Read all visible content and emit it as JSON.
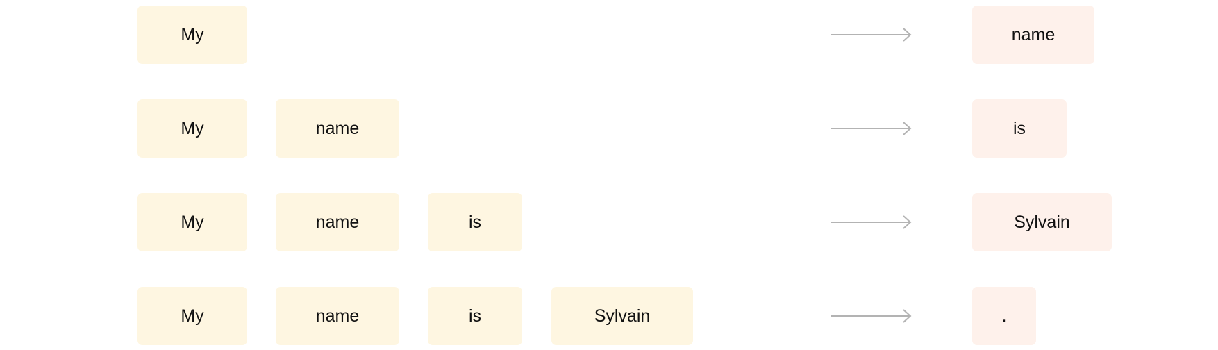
{
  "rows": [
    {
      "inputs": [
        "My"
      ],
      "output": "name"
    },
    {
      "inputs": [
        "My",
        "name"
      ],
      "output": "is"
    },
    {
      "inputs": [
        "My",
        "name",
        "is"
      ],
      "output": "Sylvain"
    },
    {
      "inputs": [
        "My",
        "name",
        "is",
        "Sylvain"
      ],
      "output": "."
    }
  ],
  "colors": {
    "input_token_bg": "#fef6e1",
    "output_token_bg": "#fef1eb",
    "arrow": "#b3b3b3",
    "text": "#111111"
  },
  "icons": {
    "arrow": "right-arrow-icon"
  }
}
